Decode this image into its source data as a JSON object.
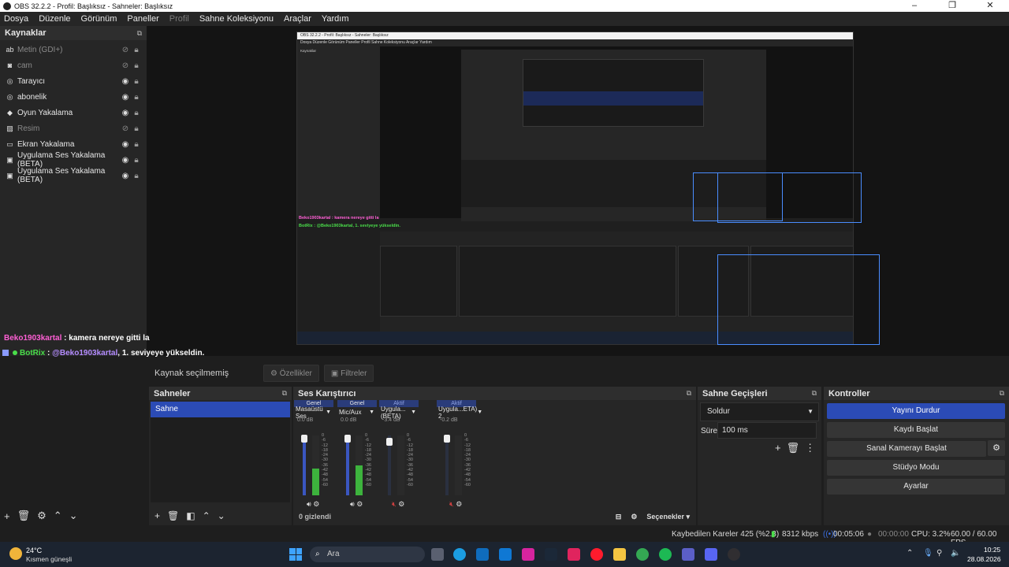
{
  "window": {
    "title": "OBS 32.2.2 - Profil: Başlıksız - Sahneler: Başlıksız",
    "controls": [
      "–",
      "❐",
      "✕"
    ]
  },
  "menu": {
    "items": [
      "Dosya",
      "Düzenle",
      "Görünüm",
      "Paneller",
      "Profil",
      "Sahne Koleksiyonu",
      "Araçlar",
      "Yardım"
    ],
    "disabled_item": "Profil"
  },
  "sources": {
    "title": "Kaynaklar",
    "items": [
      {
        "label": "Metin (GDI+)",
        "icon": "text-icon",
        "visible": false
      },
      {
        "label": "cam",
        "icon": "camera-icon",
        "visible": false
      },
      {
        "label": "Tarayıcı",
        "icon": "globe-icon",
        "visible": true
      },
      {
        "label": "abonelik",
        "icon": "globe-icon",
        "visible": true
      },
      {
        "label": "Oyun Yakalama",
        "icon": "gamepad-icon",
        "visible": true
      },
      {
        "label": "Resim",
        "icon": "image-icon",
        "visible": false
      },
      {
        "label": "Ekran Yakalama",
        "icon": "monitor-icon",
        "visible": true
      },
      {
        "label": "Uygulama Ses Yakalama (BETA)",
        "icon": "app-audio-icon",
        "visible": true
      },
      {
        "label": "Uygulama Ses Yakalama (BETA)",
        "icon": "app-audio-icon",
        "visible": true
      }
    ]
  },
  "chat": [
    {
      "user": "Beko1903kartal",
      "sep": " : ",
      "message": "kamera nereye gitti la"
    },
    {
      "user": "BotRix",
      "sep": " : ",
      "mention": "@Beko1903kartal",
      "message": ", 1. seviyeye yükseldin."
    }
  ],
  "context": {
    "no_selection": "Kaynak seçilmemiş",
    "properties": "Özellikler",
    "filters": "Filtreler"
  },
  "scenes": {
    "title": "Sahneler",
    "items": [
      "Sahne"
    ]
  },
  "mixer": {
    "title": "Ses Karıştırıcı",
    "channels": [
      {
        "tag": "Genel",
        "name": "Masaüstü Ses",
        "db": "0.0 dB",
        "level": 0.45,
        "muted": false,
        "fader": 0.95
      },
      {
        "tag": "Genel",
        "name": "Mic/Aux",
        "db": "0.0 dB",
        "level": 0.5,
        "muted": false,
        "fader": 0.95
      },
      {
        "tag": "Aktif",
        "name": "Uygula...(BETA)",
        "db": "-3.4 dB",
        "level": 0,
        "muted": true,
        "fader": 0.9
      },
      {
        "tag": "Aktif",
        "name": "Uygula...ETA) 2",
        "db": "-0.2 dB",
        "level": 0,
        "muted": true,
        "fader": 0.95
      }
    ],
    "scale": [
      "0",
      "-6",
      "-12",
      "-18",
      "-24",
      "-30",
      "-36",
      "-42",
      "-48",
      "-54",
      "-60"
    ],
    "hidden": "0 gizlendi",
    "options": "Seçenekler"
  },
  "transitions": {
    "title": "Sahne Geçişleri",
    "selected": "Soldur",
    "duration_label": "Süre",
    "duration_value": "100 ms"
  },
  "controls": {
    "title": "Kontroller",
    "stop_stream": "Yayını Durdur",
    "start_recording": "Kaydı Başlat",
    "start_virtualcam": "Sanal Kamerayı Başlat",
    "studio_mode": "Stüdyo Modu",
    "settings": "Ayarlar"
  },
  "status": {
    "dropped_frames": "Kaybedilen Kareler 425 (%2.3)",
    "bitrate": "8312 kbps",
    "stream_time": "00:05:06",
    "record_time": "00:00:00",
    "cpu": "CPU: 3.2%",
    "fps": "60.00 / 60.00 FPS"
  },
  "taskbar": {
    "temp": "24°C",
    "weather": "Kısmen güneşli",
    "search": "Ara",
    "time": "10:25",
    "date": "28.08.2026"
  },
  "nested_preview": {
    "title": "OBS 32.2.2 - Profil: Başlıksız - Sahneler: Başlıksız",
    "menu": "Dosya   Düzenle   Görünüm   Paneller   Profil   Sahne Koleksiyonu   Araçlar   Yardım",
    "sources_title": "Kaynaklar",
    "chat1": "Beko1903kartal : kamera nereye gitti la",
    "chat2": "BotRix : @Beko1903kartal, 1. seviyeye yükseldin."
  },
  "colors": {
    "accent": "#2b4bb5",
    "chat_user1": "#ff5fd5",
    "chat_user2": "#4ade4a",
    "mention": "#b48cff",
    "outline": "#4a8dff"
  }
}
